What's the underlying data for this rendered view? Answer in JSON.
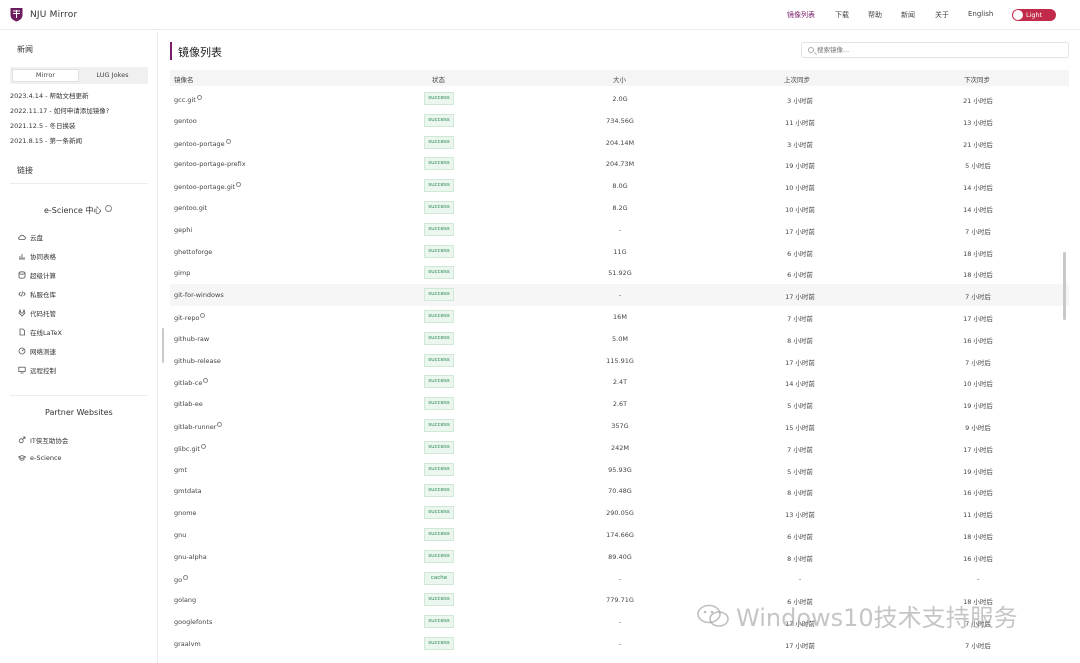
{
  "topbar": {
    "brand": "NJU Mirror",
    "nav": [
      "镜像列表",
      "下载",
      "帮助",
      "新闻",
      "关于",
      "English"
    ],
    "theme_label": "Light"
  },
  "sidebar": {
    "news_heading": "新闻",
    "tabs": [
      "Mirror",
      "LUG Jokes"
    ],
    "news": [
      "2023.4.14 - 帮助文档更新",
      "2022.11.17 - 如何申请添加镜像?",
      "2021.12.5 - 冬日换装",
      "2021.8.15 - 第一条新闻"
    ],
    "links_heading": "链接",
    "escience_title": "e-Science 中心",
    "escience_links": [
      "云盘",
      "协同表格",
      "超级计算",
      "私服仓库",
      "代码托管",
      "在线LaTeX",
      "网络测速",
      "远程控制"
    ],
    "partner_title": "Partner Websites",
    "partner_links": [
      "IT侠互助协会",
      "e-Science"
    ]
  },
  "main": {
    "title": "镜像列表",
    "search_placeholder": "搜索镜像...",
    "columns": [
      "镜像名",
      "状态",
      "大小",
      "上次同步",
      "下次同步"
    ],
    "rows": [
      {
        "name": "gcc.git",
        "hint": true,
        "status": "success",
        "size": "2.0G",
        "last": "3 小时前",
        "next": "21 小时后"
      },
      {
        "name": "gentoo",
        "hint": false,
        "status": "success",
        "size": "734.56G",
        "last": "11 小时前",
        "next": "13 小时后"
      },
      {
        "name": "gentoo-portage",
        "hint": true,
        "status": "success",
        "size": "204.14M",
        "last": "3 小时前",
        "next": "21 小时后"
      },
      {
        "name": "gentoo-portage-prefix",
        "hint": false,
        "status": "success",
        "size": "204.73M",
        "last": "19 小时前",
        "next": "5 小时后"
      },
      {
        "name": "gentoo-portage.git",
        "hint": true,
        "status": "success",
        "size": "8.0G",
        "last": "10 小时前",
        "next": "14 小时后"
      },
      {
        "name": "gentoo.git",
        "hint": false,
        "status": "success",
        "size": "8.2G",
        "last": "10 小时前",
        "next": "14 小时后"
      },
      {
        "name": "gephi",
        "hint": false,
        "status": "success",
        "size": "-",
        "last": "17 小时前",
        "next": "7 小时后"
      },
      {
        "name": "ghettoforge",
        "hint": false,
        "status": "success",
        "size": "11G",
        "last": "6 小时前",
        "next": "18 小时后"
      },
      {
        "name": "gimp",
        "hint": false,
        "status": "success",
        "size": "51.92G",
        "last": "6 小时前",
        "next": "18 小时后"
      },
      {
        "name": "git-for-windows",
        "hint": false,
        "status": "success",
        "size": "-",
        "last": "17 小时前",
        "next": "7 小时后"
      },
      {
        "name": "git-repo",
        "hint": true,
        "status": "success",
        "size": "16M",
        "last": "7 小时前",
        "next": "17 小时后"
      },
      {
        "name": "github-raw",
        "hint": false,
        "status": "success",
        "size": "5.0M",
        "last": "8 小时前",
        "next": "16 小时后"
      },
      {
        "name": "github-release",
        "hint": false,
        "status": "success",
        "size": "115.91G",
        "last": "17 小时前",
        "next": "7 小时后"
      },
      {
        "name": "gitlab-ce",
        "hint": true,
        "status": "success",
        "size": "2.4T",
        "last": "14 小时前",
        "next": "10 小时后"
      },
      {
        "name": "gitlab-ee",
        "hint": false,
        "status": "success",
        "size": "2.6T",
        "last": "5 小时前",
        "next": "19 小时后"
      },
      {
        "name": "gitlab-runner",
        "hint": true,
        "status": "success",
        "size": "357G",
        "last": "15 小时前",
        "next": "9 小时后"
      },
      {
        "name": "glibc.git",
        "hint": true,
        "status": "success",
        "size": "242M",
        "last": "7 小时前",
        "next": "17 小时后"
      },
      {
        "name": "gmt",
        "hint": false,
        "status": "success",
        "size": "95.93G",
        "last": "5 小时前",
        "next": "19 小时后"
      },
      {
        "name": "gmtdata",
        "hint": false,
        "status": "success",
        "size": "70.48G",
        "last": "8 小时前",
        "next": "16 小时后"
      },
      {
        "name": "gnome",
        "hint": false,
        "status": "success",
        "size": "290.05G",
        "last": "13 小时前",
        "next": "11 小时后"
      },
      {
        "name": "gnu",
        "hint": false,
        "status": "success",
        "size": "174.66G",
        "last": "6 小时前",
        "next": "18 小时后"
      },
      {
        "name": "gnu-alpha",
        "hint": false,
        "status": "success",
        "size": "89.40G",
        "last": "8 小时前",
        "next": "16 小时后"
      },
      {
        "name": "go",
        "hint": true,
        "status": "cache",
        "size": "-",
        "last": "-",
        "next": "-"
      },
      {
        "name": "golang",
        "hint": false,
        "status": "success",
        "size": "779.71G",
        "last": "6 小时前",
        "next": "18 小时后"
      },
      {
        "name": "googlefonts",
        "hint": false,
        "status": "success",
        "size": "-",
        "last": "17 小时前",
        "next": "7 小时后"
      },
      {
        "name": "graalvm",
        "hint": false,
        "status": "success",
        "size": "-",
        "last": "17 小时前",
        "next": "7 小时后"
      }
    ]
  },
  "watermark": "Windows10技术支持服务",
  "colors": {
    "accent": "#7a1b6b",
    "toggle": "#c22a4a",
    "success": "#2e8b57"
  }
}
